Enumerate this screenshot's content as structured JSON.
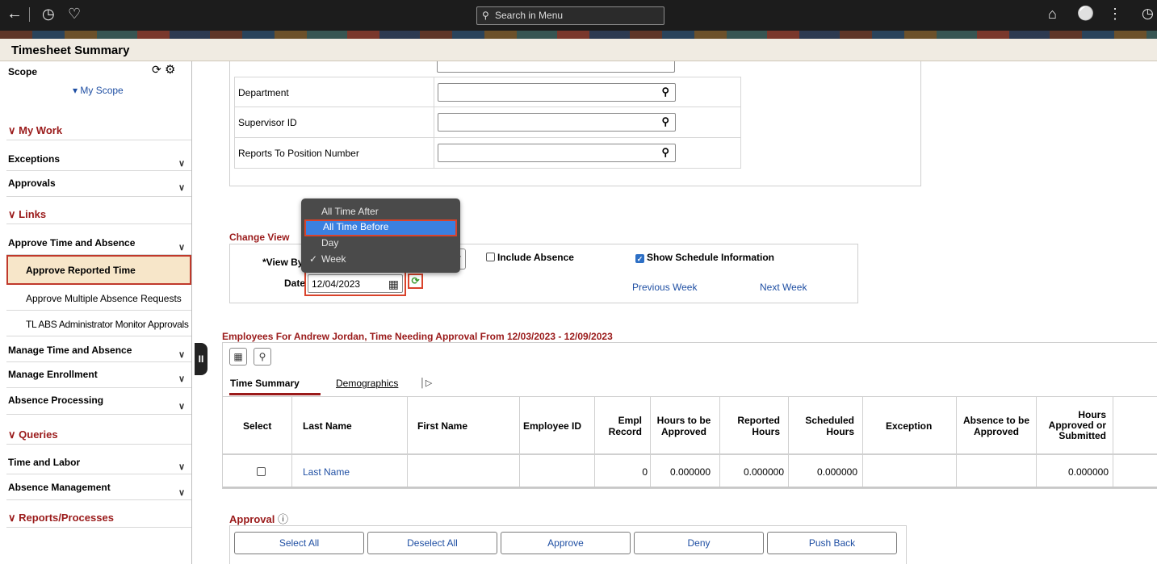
{
  "topbar": {
    "search_placeholder": "Search in Menu",
    "icons": [
      "back-arrow-icon",
      "history-icon",
      "favorites-heart-icon",
      "home-icon",
      "notifications-bell-icon",
      "actions-menu-icon",
      "navbar-icon"
    ]
  },
  "page": {
    "title": "Timesheet Summary"
  },
  "sidebar": {
    "scope_label": "Scope",
    "my_scope_link": "My Scope",
    "sections": {
      "my_work": "My Work",
      "links": "Links",
      "queries": "Queries",
      "reports": "Reports/Processes"
    },
    "items": {
      "exceptions": "Exceptions",
      "approvals": "Approvals",
      "approve_time_absence": "Approve Time and Absence",
      "approve_reported_time": "Approve Reported Time",
      "approve_multiple_absence": "Approve Multiple Absence Requests",
      "tl_abs_monitor": "TL ABS Administrator Monitor Approvals",
      "manage_time_absence": "Manage Time and Absence",
      "manage_enrollment": "Manage Enrollment",
      "absence_processing": "Absence Processing",
      "time_and_labor": "Time and Labor",
      "absence_management": "Absence Management"
    }
  },
  "criteria": {
    "department_label": "Department",
    "supervisor_label": "Supervisor ID",
    "reports_to_label": "Reports To Position Number"
  },
  "change_view": {
    "title": "Change View",
    "view_by_label": "*View By",
    "include_absence_label": "Include Absence",
    "include_absence_checked": false,
    "show_schedule_label": "Show Schedule Information",
    "show_schedule_checked": true,
    "date_label": "Date",
    "date_value": "12/04/2023",
    "previous_week": "Previous Week",
    "next_week": "Next Week",
    "dropdown_options": [
      "All Time After",
      "All Time Before",
      "Day",
      "Week"
    ],
    "dropdown_highlighted": "All Time Before",
    "dropdown_checked": "Week"
  },
  "employees": {
    "title": "Employees For Andrew Jordan, Time Needing Approval From 12/03/2023 - 12/09/2023",
    "tabs": [
      "Time Summary",
      "Demographics"
    ],
    "columns": [
      "Select",
      "Last Name",
      "First Name",
      "Employee ID",
      "Empl Record",
      "Hours to be Approved",
      "Reported Hours",
      "Scheduled Hours",
      "Exception",
      "Absence to be Approved",
      "Hours Approved or Submitted"
    ],
    "row": {
      "last_name": "Last Name",
      "empl_record": "0",
      "hours_to_be_approved": "0.000000",
      "reported_hours": "0.000000",
      "scheduled_hours": "0.000000",
      "hours_approved": "0.000000"
    }
  },
  "approval": {
    "title": "Approval",
    "buttons": [
      "Select All",
      "Deselect All",
      "Approve",
      "Deny",
      "Push Back"
    ]
  },
  "colors": {
    "accent_red": "#9a1a1a",
    "link_blue": "#1f4fa3",
    "highlight_border": "#d9432b",
    "dropdown_selected": "#3b80e0"
  }
}
